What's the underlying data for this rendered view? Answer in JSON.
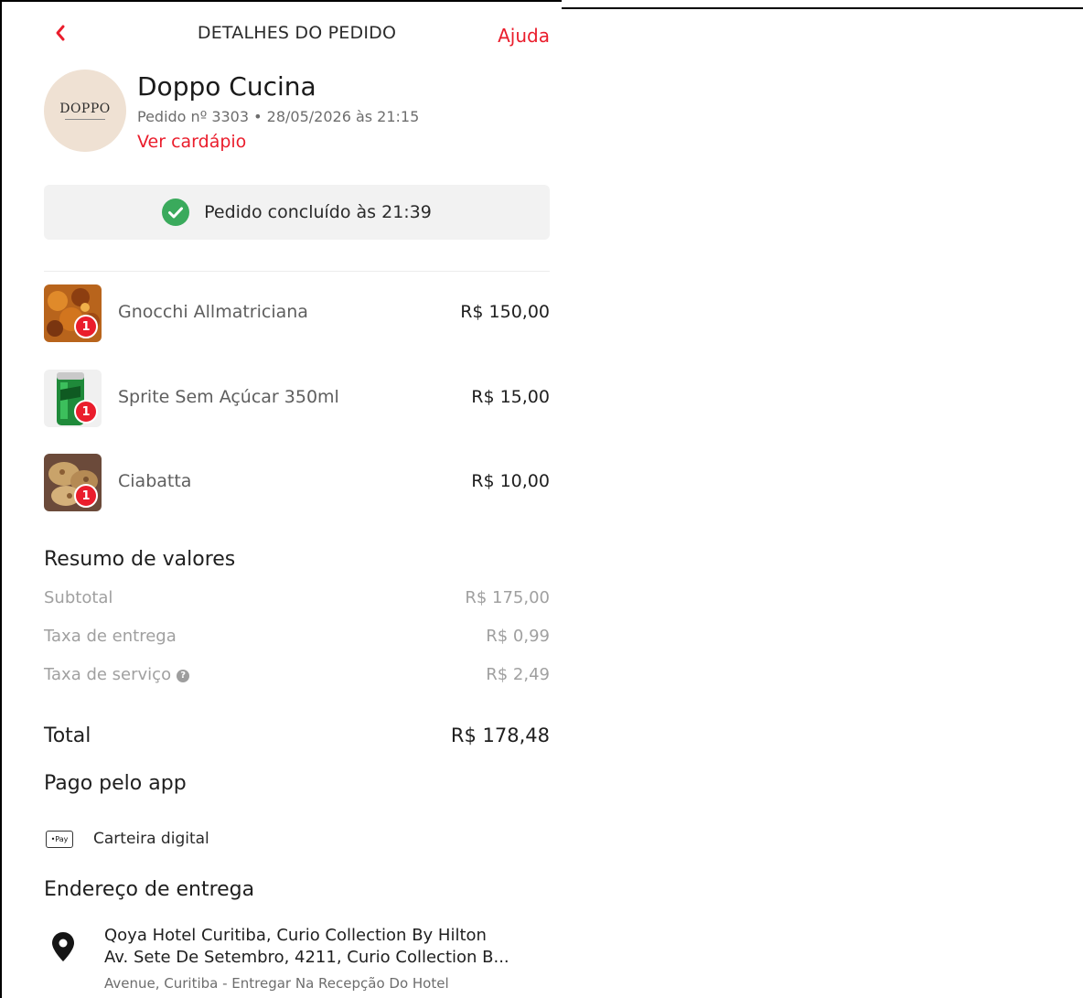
{
  "header": {
    "title": "DETALHES DO PEDIDO",
    "help_label": "Ajuda"
  },
  "store": {
    "logo_text": "DOPPO",
    "name": "Doppo Cucina",
    "meta": "Pedido nº 3303 • 28/05/2026 às 21:15",
    "menu_link": "Ver cardápio"
  },
  "status": {
    "text": "Pedido concluído às 21:39"
  },
  "items": [
    {
      "name": "Gnocchi Allmatriciana",
      "price": "R$ 150,00",
      "quantity": "1"
    },
    {
      "name": "Sprite Sem Açúcar 350ml",
      "price": "R$ 15,00",
      "quantity": "1"
    },
    {
      "name": "Ciabatta",
      "price": "R$ 10,00",
      "quantity": "1"
    }
  ],
  "summary": {
    "title": "Resumo de valores",
    "subtotal_label": "Subtotal",
    "subtotal_value": "R$ 175,00",
    "delivery_label": "Taxa de entrega",
    "delivery_value": "R$ 0,99",
    "service_label": "Taxa de serviço",
    "service_value": "R$ 2,49",
    "total_label": "Total",
    "total_value": "R$ 178,48"
  },
  "payment": {
    "title": "Pago pelo app",
    "badge": "•Pay",
    "method": "Carteira digital"
  },
  "address": {
    "title": "Endereço de entrega",
    "line1": "Qoya Hotel Curitiba, Curio Collection By Hilton",
    "line2": "Av. Sete De Setembro, 4211, Curio Collection B...",
    "line3": "Avenue, Curitiba - Entregar Na Recepção Do Hotel"
  },
  "colors": {
    "accent": "#ea1d2c",
    "success": "#3aaa5c",
    "status_bg": "#f2f2f2"
  },
  "icons": {
    "back": "chevron-left-icon",
    "status": "check-circle-icon",
    "info": "info-icon",
    "location": "location-pin-icon"
  }
}
